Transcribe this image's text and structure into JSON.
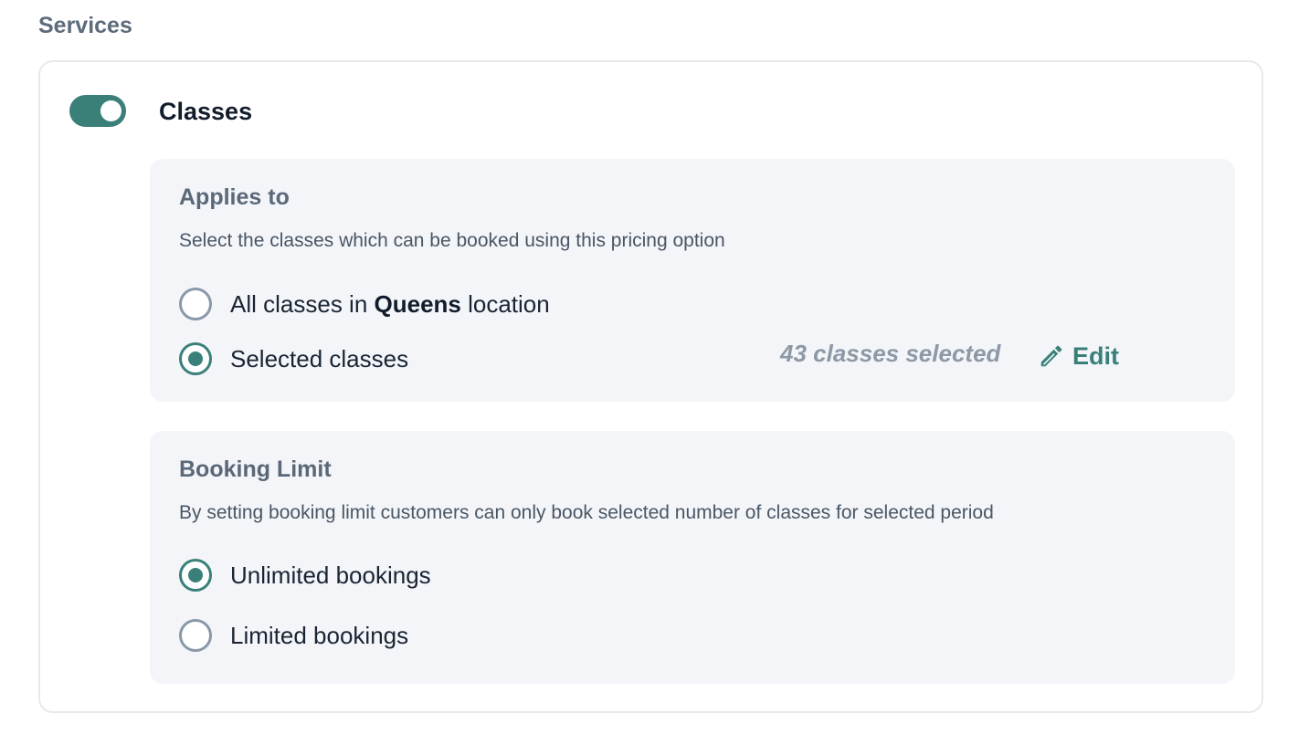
{
  "section": {
    "title": "Services"
  },
  "service": {
    "toggle_on": true,
    "label": "Classes"
  },
  "applies_to": {
    "title": "Applies to",
    "description": "Select the classes which can be booked using this pricing option",
    "options": [
      {
        "label_prefix": "All classes in ",
        "label_bold": "Queens",
        "label_suffix": " location",
        "checked": false
      },
      {
        "label": "Selected classes",
        "checked": true
      }
    ],
    "selected_count_text": "43 classes selected",
    "edit_label": "Edit"
  },
  "booking_limit": {
    "title": "Booking Limit",
    "description": "By setting booking limit customers can only book selected number of classes for selected period",
    "options": [
      {
        "label": "Unlimited bookings",
        "checked": true
      },
      {
        "label": "Limited bookings",
        "checked": false
      }
    ]
  },
  "colors": {
    "accent": "#3a8079",
    "panel_background": "#f3f5f9",
    "muted_text": "#8e99a5"
  }
}
